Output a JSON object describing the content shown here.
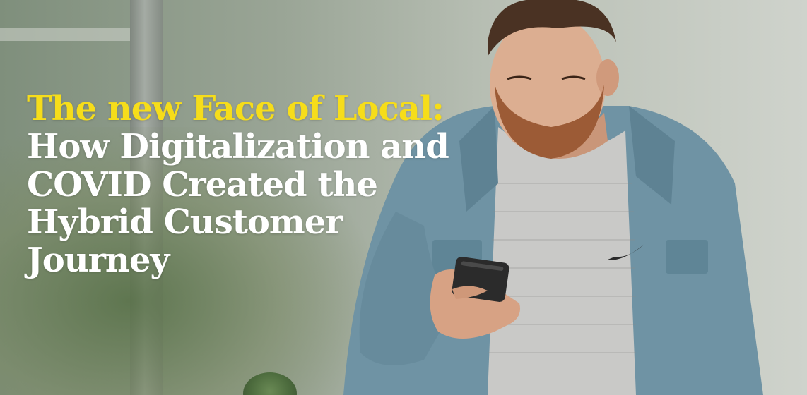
{
  "hero": {
    "headline_accent": "The new Face of Local:",
    "headline_lines": [
      "How Digitalization and",
      "COVID Created the",
      "Hybrid Customer",
      "Journey"
    ]
  },
  "colors": {
    "accent_yellow": "#f6dd1a",
    "headline_white": "#ffffff"
  },
  "illustration": {
    "subject": "man-with-beard-looking-at-phone",
    "shirt_logo": "swoosh-logo"
  }
}
